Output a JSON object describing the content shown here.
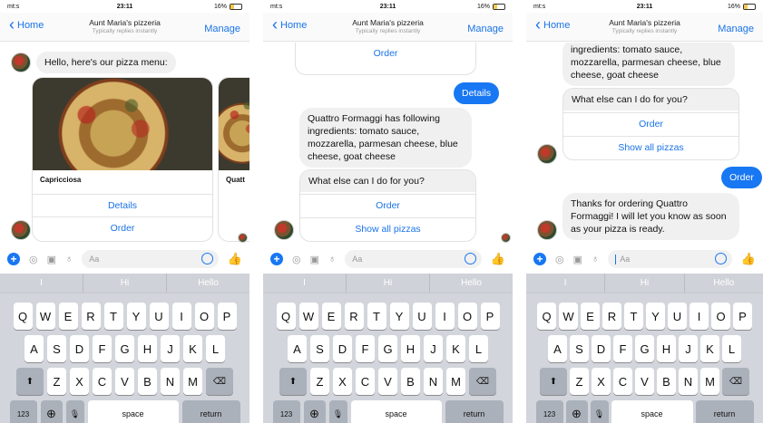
{
  "status": {
    "carrier": "mt:s",
    "time": "23:11",
    "battery": "16%"
  },
  "nav": {
    "back_label": "Home",
    "title": "Aunt Maria's pizzeria",
    "subtitle": "Typically replies instantly",
    "manage_label": "Manage"
  },
  "screen1": {
    "greeting": "Hello, here's our pizza menu:",
    "card_title": "Capricciosa",
    "card_title_next": "Quatt",
    "details_label": "Details",
    "order_label": "Order"
  },
  "screen2": {
    "top_order": "Order",
    "details_user": "Details",
    "ingredients": "Quattro Formaggi has following ingredients: tomato sauce, mozzarella, parmesan cheese, blue cheese, goat cheese",
    "question": "What else can I do for you?",
    "order_label": "Order",
    "show_all": "Show all pizzas"
  },
  "screen3": {
    "ingredients_tail": "ingredients: tomato sauce, mozzarella, parmesan cheese, blue cheese, goat cheese",
    "question": "What else can I do for you?",
    "order_label": "Order",
    "show_all": "Show all pizzas",
    "order_user": "Order",
    "thanks": "Thanks for ordering Quattro Formaggi! I will let you know as soon as your pizza is ready."
  },
  "input": {
    "placeholder": "Aa"
  },
  "keyboard": {
    "suggestions": [
      "I",
      "Hi",
      "Hello"
    ],
    "row1": [
      "Q",
      "W",
      "E",
      "R",
      "T",
      "Y",
      "U",
      "I",
      "O",
      "P"
    ],
    "row2": [
      "A",
      "S",
      "D",
      "F",
      "G",
      "H",
      "J",
      "K",
      "L"
    ],
    "row3": [
      "Z",
      "X",
      "C",
      "V",
      "B",
      "N",
      "M"
    ],
    "num_label": "123",
    "space_label": "space",
    "return_label": "return"
  },
  "colors": {
    "accent": "#1877f2",
    "bubble": "#f0f0f0",
    "keyboard_bg": "#d2d5db"
  }
}
